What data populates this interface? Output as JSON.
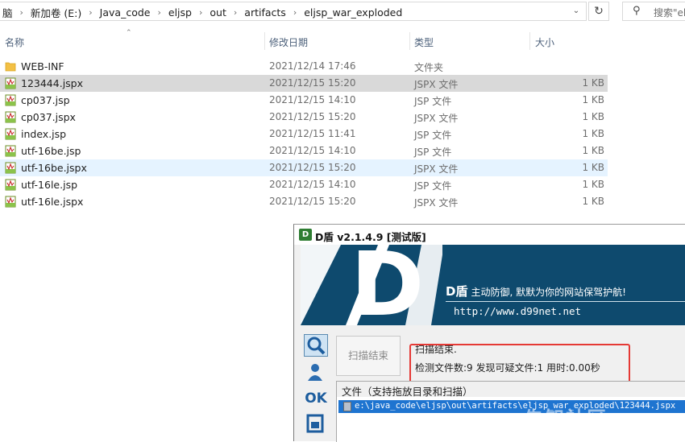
{
  "address": {
    "crumbs": [
      "脑",
      "新加卷 (E:)",
      "Java_code",
      "eljsp",
      "out",
      "artifacts",
      "eljsp_war_exploded"
    ],
    "search_placeholder": "搜索\"el"
  },
  "columns": {
    "name": "名称",
    "date": "修改日期",
    "type": "类型",
    "size": "大小"
  },
  "files": [
    {
      "name": "WEB-INF",
      "date": "2021/12/14 17:46",
      "type": "文件夹",
      "size": "",
      "icon": "folder-icon",
      "state": "normal"
    },
    {
      "name": "123444.jspx",
      "date": "2021/12/15 15:20",
      "type": "JSPX 文件",
      "size": "1 KB",
      "icon": "jsp-file-icon",
      "state": "selected"
    },
    {
      "name": "cp037.jsp",
      "date": "2021/12/15 14:10",
      "type": "JSP 文件",
      "size": "1 KB",
      "icon": "jsp-file-icon",
      "state": "normal"
    },
    {
      "name": "cp037.jspx",
      "date": "2021/12/15 15:20",
      "type": "JSPX 文件",
      "size": "1 KB",
      "icon": "jsp-file-icon",
      "state": "normal"
    },
    {
      "name": "index.jsp",
      "date": "2021/12/15 11:41",
      "type": "JSP 文件",
      "size": "1 KB",
      "icon": "jsp-file-icon",
      "state": "normal"
    },
    {
      "name": "utf-16be.jsp",
      "date": "2021/12/15 14:10",
      "type": "JSP 文件",
      "size": "1 KB",
      "icon": "jsp-file-icon",
      "state": "normal"
    },
    {
      "name": "utf-16be.jspx",
      "date": "2021/12/15 15:20",
      "type": "JSPX 文件",
      "size": "1 KB",
      "icon": "jsp-file-icon",
      "state": "hover"
    },
    {
      "name": "utf-16le.jsp",
      "date": "2021/12/15 14:10",
      "type": "JSP 文件",
      "size": "1 KB",
      "icon": "jsp-file-icon",
      "state": "normal"
    },
    {
      "name": "utf-16le.jspx",
      "date": "2021/12/15 15:20",
      "type": "JSPX 文件",
      "size": "1 KB",
      "icon": "jsp-file-icon",
      "state": "normal"
    }
  ],
  "dshield": {
    "title": "D盾 v2.1.4.9 [测试版]",
    "banner_brand": "D盾",
    "banner_slogan": "主动防御, 默默为你的网站保驾护航!",
    "banner_url": "http://www.d99net.net",
    "logo_letter": "D",
    "side_ok": "OK",
    "scan_button": "扫描结束",
    "status_line1": "扫描结束.",
    "status_line2": "检测文件数:9 发现可疑文件:1 用时:0.00秒",
    "list_header": "文件（支持拖放目录和扫描）",
    "list_rows": [
      "e:\\java_code\\eljsp\\out\\artifacts\\eljsp_war_exploded\\123444.jspx"
    ]
  },
  "watermark": "先知社区",
  "colors": {
    "selected_row": "#d9d9d9",
    "hover_row": "#e5f3ff",
    "banner_bg": "#0e4a6e",
    "highlight_box": "#e53935",
    "list_selection": "#1e74d0"
  }
}
